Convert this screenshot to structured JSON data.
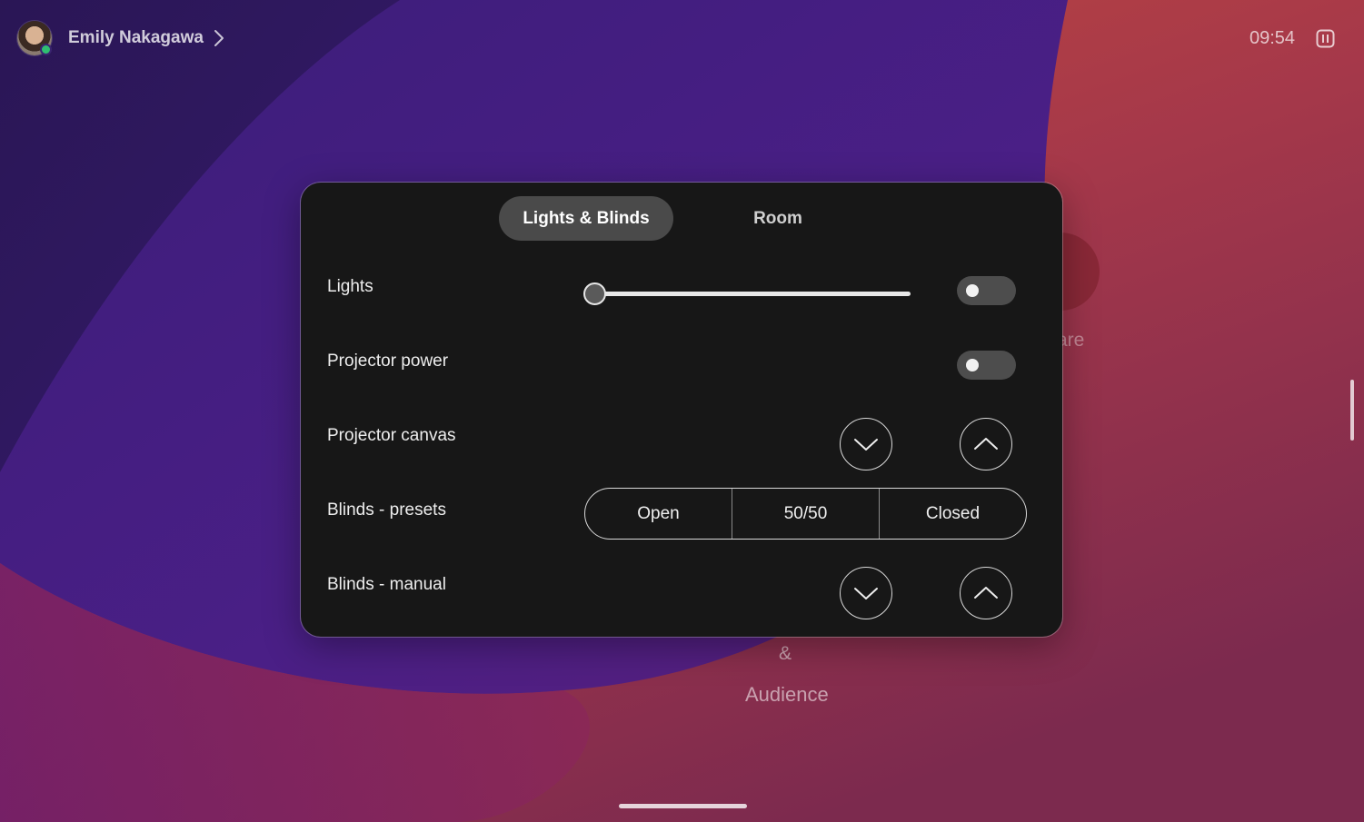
{
  "header": {
    "user_name": "Emily Nakagawa",
    "time": "09:54"
  },
  "background": {
    "share_label": "are",
    "amp_label": "&",
    "audience_label": "Audience"
  },
  "panel": {
    "tabs": [
      {
        "label": "Lights & Blinds",
        "active": true
      },
      {
        "label": "Room",
        "active": false
      }
    ],
    "rows": {
      "lights": {
        "label": "Lights",
        "slider_level": 0,
        "toggle_on": false
      },
      "projector_power": {
        "label": "Projector power",
        "toggle_on": false
      },
      "projector_canvas": {
        "label": "Projector canvas"
      },
      "blinds_presets": {
        "label": "Blinds - presets",
        "options": [
          "Open",
          "50/50",
          "Closed"
        ]
      },
      "blinds_manual": {
        "label": "Blinds - manual"
      }
    }
  },
  "colors": {
    "panel_bg": "#171717",
    "active_tab_bg": "#4a4a4a",
    "bg_purple": "#3a1c7a",
    "bg_red": "#c04a3e"
  },
  "icons": {
    "down": "chevron-down-icon",
    "up": "chevron-up-icon",
    "user_chevron": "chevron-right-icon",
    "layout": "layout-icon"
  }
}
